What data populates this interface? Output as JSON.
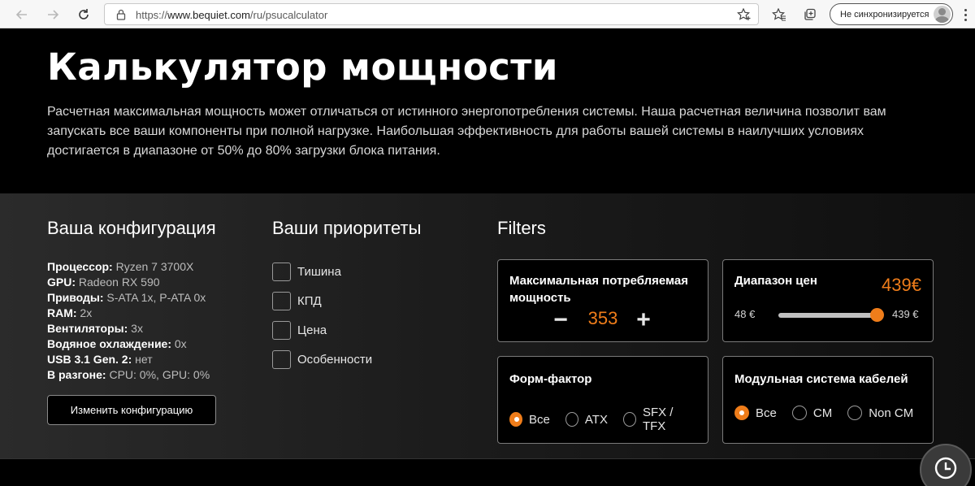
{
  "browser": {
    "url_prefix": "https://",
    "url_domain": "www.bequiet.com",
    "url_path": "/ru/psucalculator",
    "sync_label": "Не синхронизируется"
  },
  "hero": {
    "title": "Калькулятор мощности",
    "intro": "Расчетная максимальная мощность может отличаться от истинного энергопотребления системы. Наша расчетная величина позволит вам запускать все ваши компоненты при полной нагрузке. Наибольшая эффективность для работы вашей системы в наилучших условиях достигается в диапазоне от 50% до 80% загрузки блока питания."
  },
  "config": {
    "title": "Ваша конфигурация",
    "specs": [
      {
        "label": "Процессор:",
        "value": " Ryzen 7 3700X"
      },
      {
        "label": "GPU:",
        "value": " Radeon RX 590"
      },
      {
        "label": "Приводы:",
        "value": " S-ATA 1x, P-ATA 0x"
      },
      {
        "label": "RAM:",
        "value": " 2x"
      },
      {
        "label": "Вентиляторы:",
        "value": " 3x"
      },
      {
        "label": "Водяное охлаждение:",
        "value": " 0x"
      },
      {
        "label": "USB 3.1 Gen. 2:",
        "value": " нет"
      },
      {
        "label": "В разгоне:",
        "value": " CPU: 0%, GPU: 0%"
      }
    ],
    "change_button": "Изменить конфигурацию"
  },
  "priorities": {
    "title": "Ваши приоритеты",
    "items": [
      "Тишина",
      "КПД",
      "Цена",
      "Особенности"
    ]
  },
  "filters": {
    "title": "Filters",
    "max_power": {
      "title": "Максимальная потребляемая мощность",
      "minus": "−",
      "plus": "+",
      "value": "353"
    },
    "price": {
      "title": "Диапазон цен",
      "current": "439€",
      "min_label": "48 €",
      "max_label": "439 €",
      "level": 1.0
    },
    "form_factor": {
      "title": "Форм-фактор",
      "options": [
        "Все",
        "ATX",
        "SFX / TFX"
      ],
      "selected": "Все"
    },
    "cable": {
      "title": "Модульная система кабелей",
      "options": [
        "Все",
        "CM",
        "Non CM"
      ],
      "selected": "Все"
    }
  },
  "colors": {
    "accent": "#ef7d1a"
  },
  "icons": [
    "back-arrow-icon",
    "forward-arrow-icon",
    "reload-icon",
    "lock-icon",
    "add-favorite-icon",
    "favorites-icon",
    "collections-icon",
    "profile-icon",
    "more-icon",
    "history-icon"
  ]
}
